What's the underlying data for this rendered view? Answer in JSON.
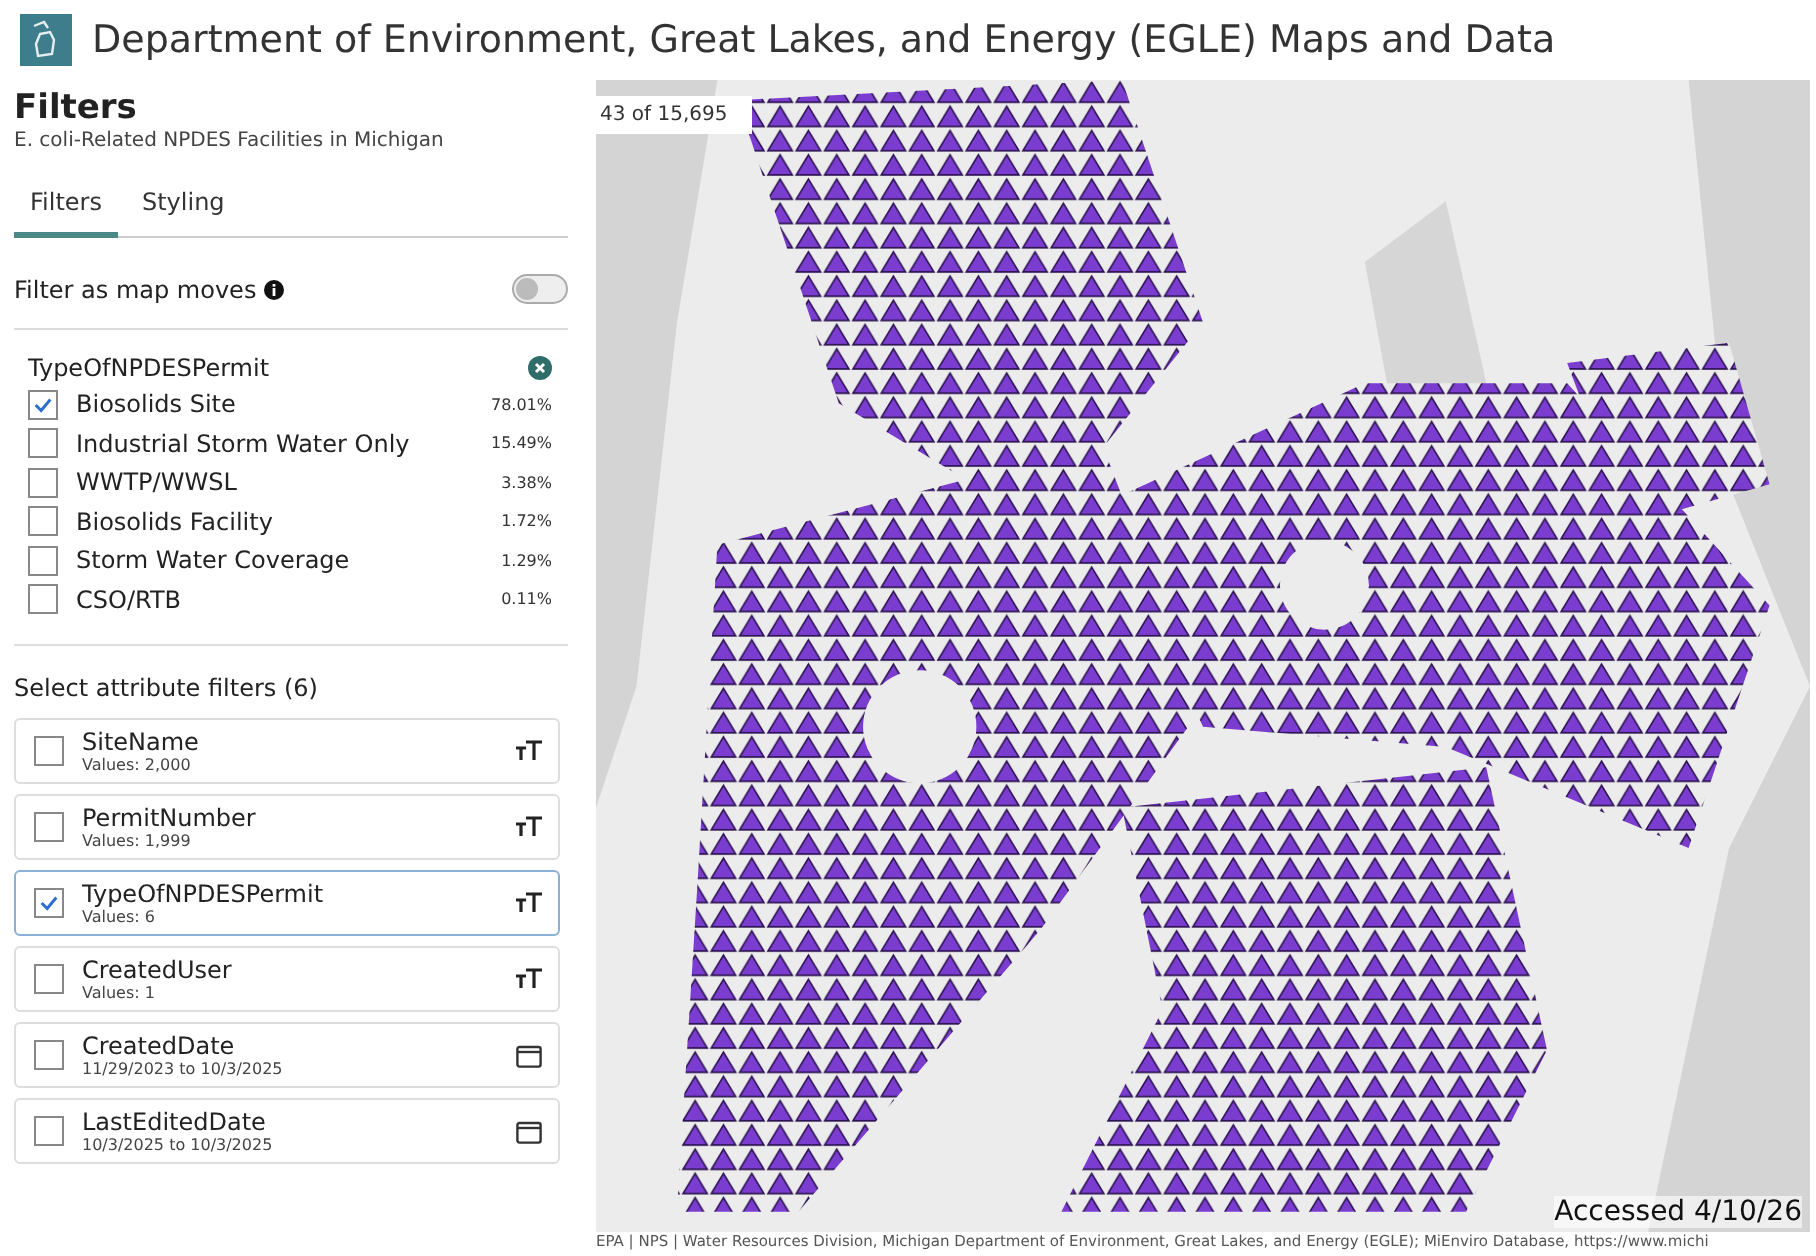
{
  "header": {
    "title": "Department of Environment, Great Lakes, and Energy (EGLE) Maps and Data"
  },
  "panel": {
    "title": "Filters",
    "subtitle": "E. coli-Related NPDES Facilities in Michigan"
  },
  "tabs": [
    {
      "label": "Filters",
      "selected": true
    },
    {
      "label": "Styling",
      "selected": false
    }
  ],
  "map_toggle": {
    "label": "Filter as map moves",
    "on": false
  },
  "permit_filter": {
    "title": "TypeOfNPDESPermit",
    "options": [
      {
        "label": "Biosolids Site",
        "share": "78.01%",
        "checked": true
      },
      {
        "label": "Industrial Storm Water Only",
        "share": "15.49%",
        "checked": false
      },
      {
        "label": "WWTP/WWSL",
        "share": "3.38%",
        "checked": false
      },
      {
        "label": "Biosolids Facility",
        "share": "1.72%",
        "checked": false
      },
      {
        "label": "Storm Water Coverage",
        "share": "1.29%",
        "checked": false
      },
      {
        "label": "CSO/RTB",
        "share": "0.11%",
        "checked": false
      }
    ]
  },
  "attribute_filters": {
    "title": "Select attribute filters (6)",
    "items": [
      {
        "name": "SiteName",
        "detail": "Values: 2,000",
        "kind": "text",
        "checked": false
      },
      {
        "name": "PermitNumber",
        "detail": "Values: 1,999",
        "kind": "text",
        "checked": false
      },
      {
        "name": "TypeOfNPDESPermit",
        "detail": "Values: 6",
        "kind": "text",
        "checked": true
      },
      {
        "name": "CreatedUser",
        "detail": "Values: 1",
        "kind": "text",
        "checked": false
      },
      {
        "name": "CreatedDate",
        "detail": "11/29/2023 to 10/3/2025",
        "kind": "date",
        "checked": false
      },
      {
        "name": "LastEditedDate",
        "detail": "10/3/2025 to 10/3/2025",
        "kind": "date",
        "checked": false
      }
    ]
  },
  "map": {
    "count": "43 of 15,695",
    "attribution": "EPA | NPS | Water Resources Division, Michigan Department of Environment, Great Lakes, and Energy (EGLE); MiEnviro Database, https://www.michi",
    "note": "Accessed 4/10/26"
  }
}
